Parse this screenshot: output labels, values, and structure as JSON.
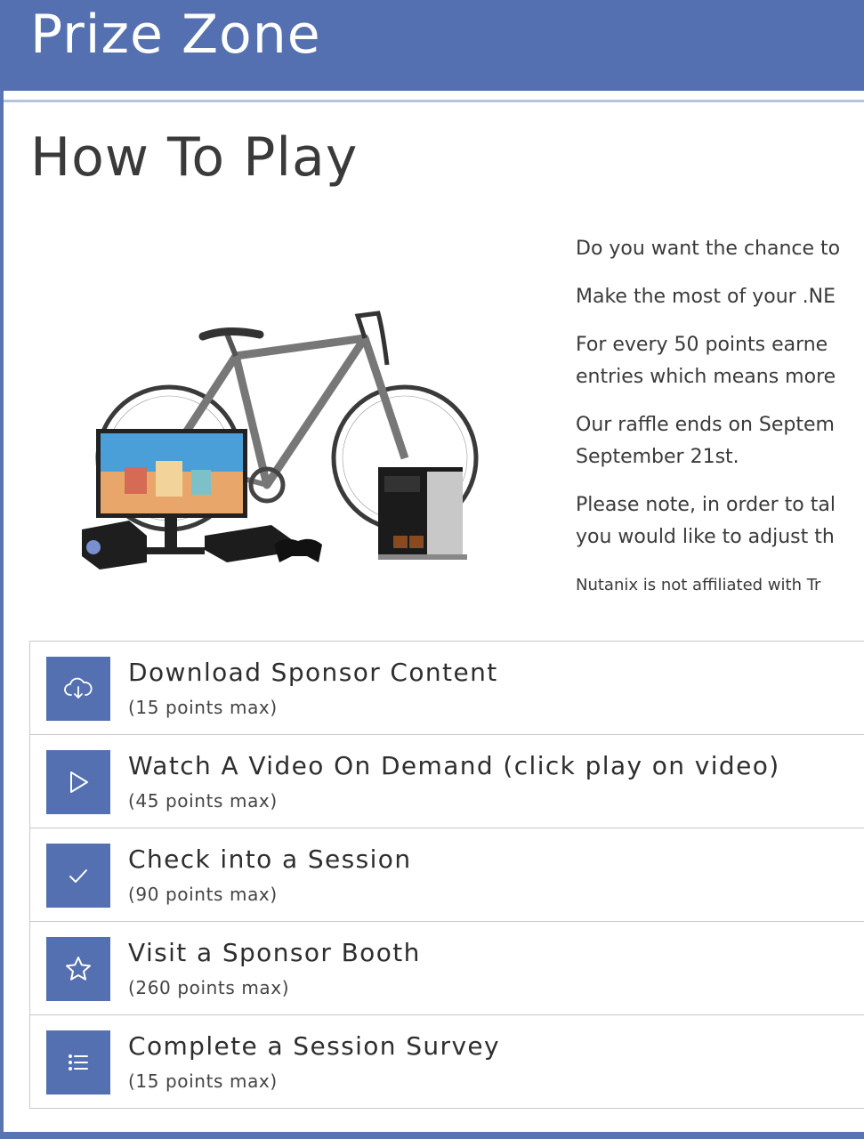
{
  "header": {
    "title": "Prize Zone"
  },
  "page": {
    "title": "How To Play"
  },
  "intro": {
    "lines": [
      "Do you want the chance to",
      "Make the most of your .NE",
      "For every 50 points earne",
      "entries which means more",
      "Our raffle ends on Septem",
      "September 21st.",
      "Please note, in order to tal",
      "you would like to adjust th"
    ],
    "disclaimer": "Nutanix is not affiliated with Tr"
  },
  "tasks": [
    {
      "title": "Download Sponsor Content",
      "points": "(15 points  max)",
      "icon": "cloud-download-icon"
    },
    {
      "title": "Watch A Video On Demand (click play on video)",
      "points": "(45 points  max)",
      "icon": "play-icon"
    },
    {
      "title": "Check into a Session",
      "points": "(90 points  max)",
      "icon": "checkmark-icon"
    },
    {
      "title": "Visit a Sponsor Booth",
      "points": "(260 points  max)",
      "icon": "star-icon"
    },
    {
      "title": "Complete a Session Survey",
      "points": "(15 points  max)",
      "icon": "list-icon"
    }
  ],
  "colors": {
    "brand": "#5470b0",
    "text": "#3a3a3a"
  }
}
